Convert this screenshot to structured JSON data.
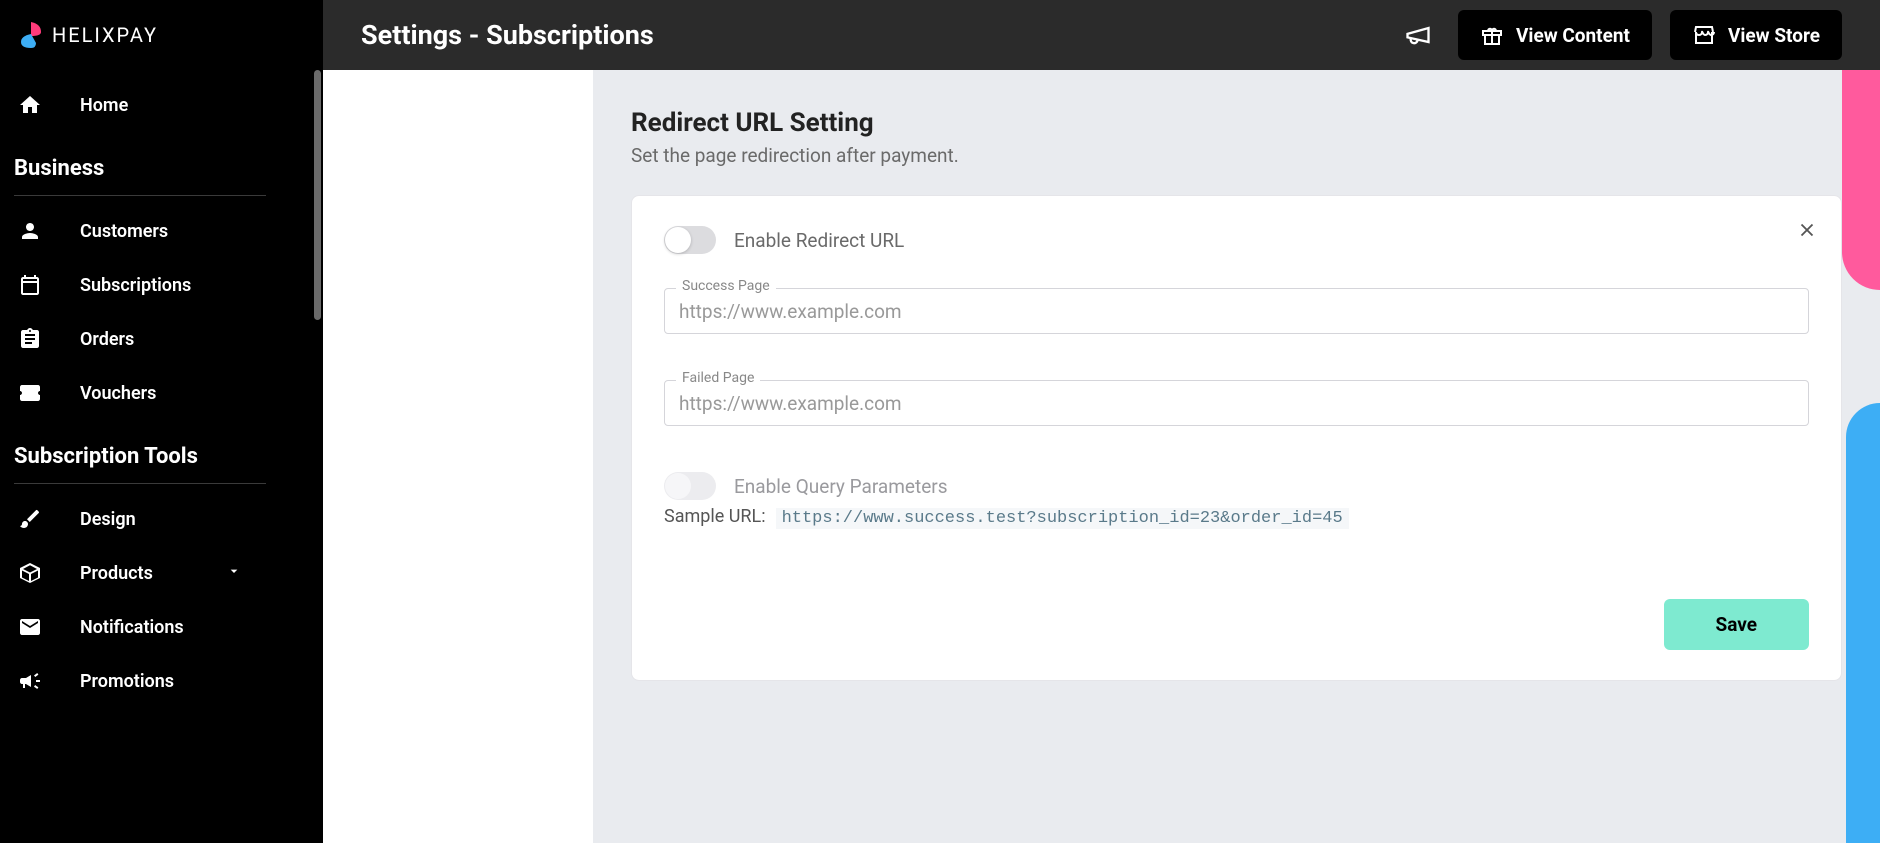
{
  "brand": "HELIXPAY",
  "sidebar": {
    "home": "Home",
    "sections": [
      {
        "title": "Business",
        "items": [
          {
            "label": "Customers"
          },
          {
            "label": "Subscriptions"
          },
          {
            "label": "Orders"
          },
          {
            "label": "Vouchers"
          }
        ]
      },
      {
        "title": "Subscription Tools",
        "items": [
          {
            "label": "Design"
          },
          {
            "label": "Products",
            "expandable": true
          },
          {
            "label": "Notifications"
          },
          {
            "label": "Promotions"
          }
        ]
      }
    ]
  },
  "topbar": {
    "title": "Settings - Subscriptions",
    "view_content_label": "View Content",
    "view_store_label": "View Store"
  },
  "section": {
    "title": "Redirect URL Setting",
    "subtitle": "Set the page redirection after payment."
  },
  "card": {
    "enable_redirect_label": "Enable Redirect URL",
    "success_page_label": "Success Page",
    "success_page_placeholder": "https://www.example.com",
    "failed_page_label": "Failed Page",
    "failed_page_placeholder": "https://www.example.com",
    "enable_query_label": "Enable Query Parameters",
    "sample_url_label": "Sample URL:",
    "sample_url_value": "https://www.success.test?subscription_id=23&order_id=45",
    "save_label": "Save"
  }
}
